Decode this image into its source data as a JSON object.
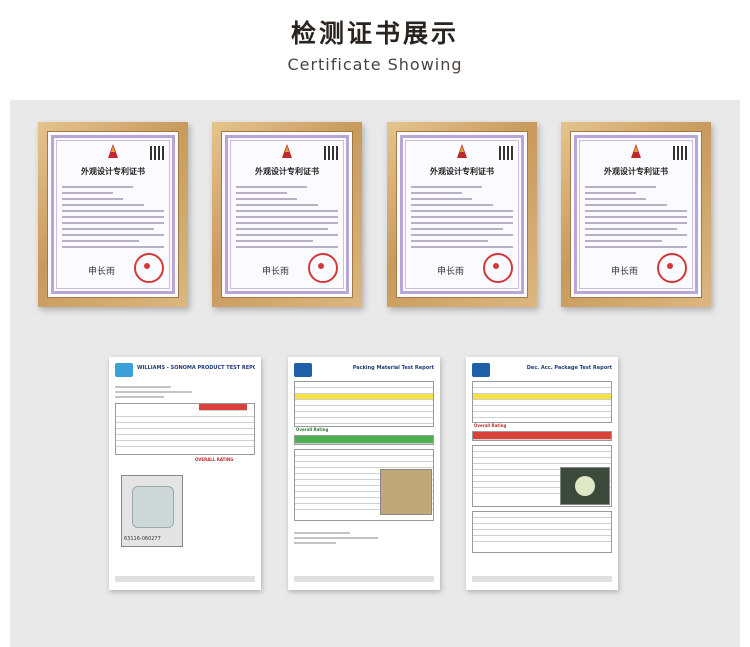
{
  "header": {
    "title_cn": "检测证书展示",
    "title_en": "Certificate Showing"
  },
  "certificates": [
    {
      "title": "外观设计专利证书",
      "signature": "申长雨"
    },
    {
      "title": "外观设计专利证书",
      "signature": "申长雨"
    },
    {
      "title": "外观设计专利证书",
      "signature": "申长雨"
    },
    {
      "title": "外观设计专利证书",
      "signature": "申长雨"
    }
  ],
  "reports": [
    {
      "heading": "WILLIAMS - SONOMA PRODUCT TEST REPORT",
      "section": "OVERALL RATING",
      "photo_label": "63116-060277"
    },
    {
      "heading": "Packing Material Test Report",
      "section": "Overall Rating"
    },
    {
      "heading": "Dec. Acc. Package Test Report",
      "section": "Overall Rating"
    }
  ],
  "colors": {
    "frame": "#c89a5c",
    "panel": "#e9e9e9",
    "stamp": "#d23a3a"
  }
}
